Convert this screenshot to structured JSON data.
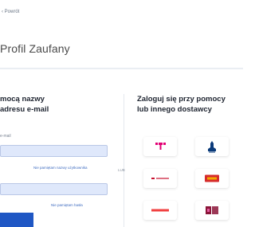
{
  "header": {
    "back_link": "‹ Powrót"
  },
  "page": {
    "title": "Profil Zaufany"
  },
  "login_panel": {
    "heading_line1": "mocą nazwy",
    "heading_line2": "adresu e-mail",
    "field_label": "e-mail",
    "login_value": "",
    "forgot_login": "Nie pamiętam nazwy użytkownika",
    "password_value": "",
    "forgot_password": "Nie pamiętam hasła"
  },
  "separator": {
    "or_label": "LUB"
  },
  "providers_panel": {
    "heading_line1": "Zaloguj się przy pomocy",
    "heading_line2": "lub innego dostawcy",
    "tiles": [
      {
        "name": "T-Mobile",
        "icon": "t-mobile-logo",
        "color": "#e20074"
      },
      {
        "name": "PKO Bank Polski",
        "icon": "pko-bp-logo",
        "color": "#0a3a7a"
      },
      {
        "name": "Bank Pekao",
        "icon": "pekao-logo",
        "color": "#c8102e"
      },
      {
        "name": "mBank",
        "icon": "mbank-logo",
        "color": "#d62b2b"
      },
      {
        "name": "Santander",
        "icon": "santander-logo",
        "color": "#ec0000"
      },
      {
        "name": "Millennium",
        "icon": "millennium-logo",
        "color": "#8b1538"
      }
    ]
  }
}
